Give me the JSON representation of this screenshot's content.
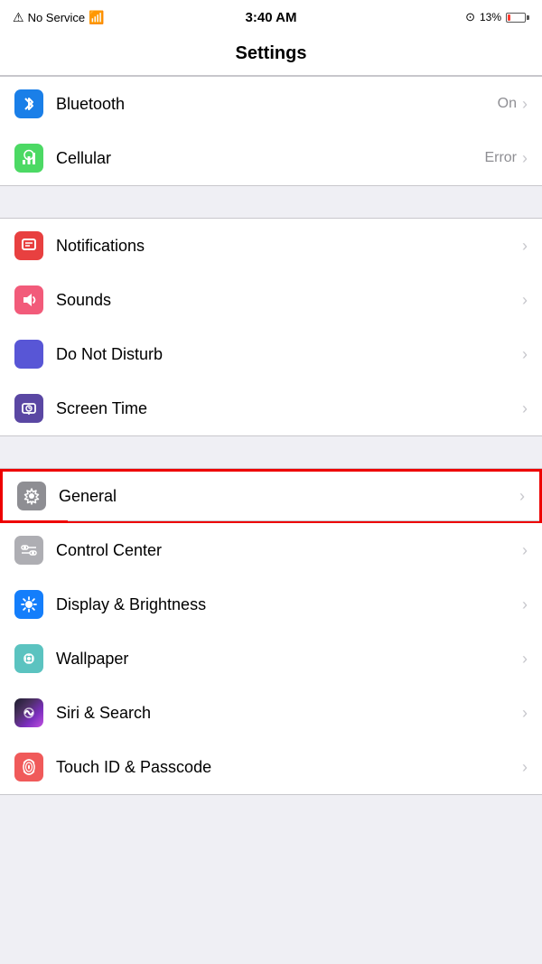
{
  "statusBar": {
    "noService": "No Service",
    "time": "3:40 AM",
    "batteryPercent": "13%"
  },
  "pageTitle": "Settings",
  "groups": [
    {
      "id": "connectivity",
      "items": [
        {
          "id": "bluetooth",
          "label": "Bluetooth",
          "value": "On",
          "iconBg": "bg-blue",
          "iconType": "bluetooth"
        },
        {
          "id": "cellular",
          "label": "Cellular",
          "value": "Error",
          "iconBg": "bg-green",
          "iconType": "cellular"
        }
      ]
    },
    {
      "id": "system1",
      "items": [
        {
          "id": "notifications",
          "label": "Notifications",
          "value": "",
          "iconBg": "bg-red-notification",
          "iconType": "notifications"
        },
        {
          "id": "sounds",
          "label": "Sounds",
          "value": "",
          "iconBg": "bg-pink",
          "iconType": "sounds"
        },
        {
          "id": "donotdisturb",
          "label": "Do Not Disturb",
          "value": "",
          "iconBg": "bg-purple",
          "iconType": "donotdisturb"
        },
        {
          "id": "screentime",
          "label": "Screen Time",
          "value": "",
          "iconBg": "bg-purple2",
          "iconType": "screentime"
        }
      ]
    },
    {
      "id": "system2",
      "items": [
        {
          "id": "general",
          "label": "General",
          "value": "",
          "iconBg": "bg-gray",
          "iconType": "general",
          "highlighted": true
        },
        {
          "id": "controlcenter",
          "label": "Control Center",
          "value": "",
          "iconBg": "bg-gray2",
          "iconType": "controlcenter"
        },
        {
          "id": "display",
          "label": "Display & Brightness",
          "value": "",
          "iconBg": "bg-blue2",
          "iconType": "display"
        },
        {
          "id": "wallpaper",
          "label": "Wallpaper",
          "value": "",
          "iconBg": "bg-teal",
          "iconType": "wallpaper"
        },
        {
          "id": "siri",
          "label": "Siri & Search",
          "value": "",
          "iconBg": "bg-gradient-siri",
          "iconType": "siri"
        },
        {
          "id": "touchid",
          "label": "Touch ID & Passcode",
          "value": "",
          "iconBg": "bg-red2",
          "iconType": "touchid"
        }
      ]
    }
  ]
}
